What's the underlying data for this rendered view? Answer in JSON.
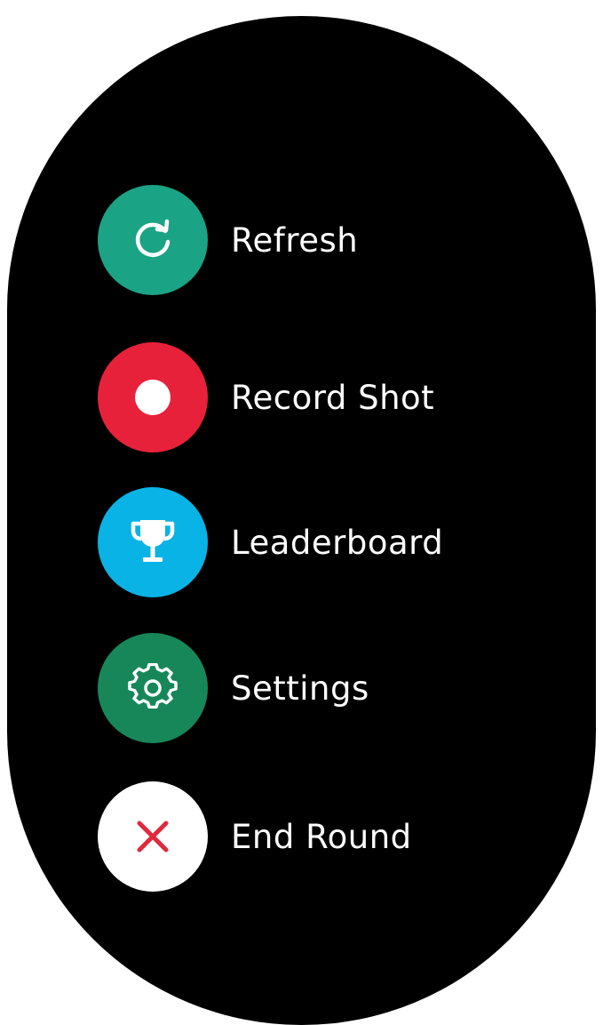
{
  "menu": {
    "items": [
      {
        "label": "Refresh",
        "icon": "refresh-icon",
        "color": "#1aa384"
      },
      {
        "label": "Record Shot",
        "icon": "record-dot-icon",
        "color": "#e8213b"
      },
      {
        "label": "Leaderboard",
        "icon": "trophy-icon",
        "color": "#0ab3e6"
      },
      {
        "label": "Settings",
        "icon": "gear-icon",
        "color": "#17875a"
      },
      {
        "label": "End Round",
        "icon": "close-icon",
        "color": "#ffffff",
        "icon_color": "#e02a3c"
      }
    ]
  }
}
